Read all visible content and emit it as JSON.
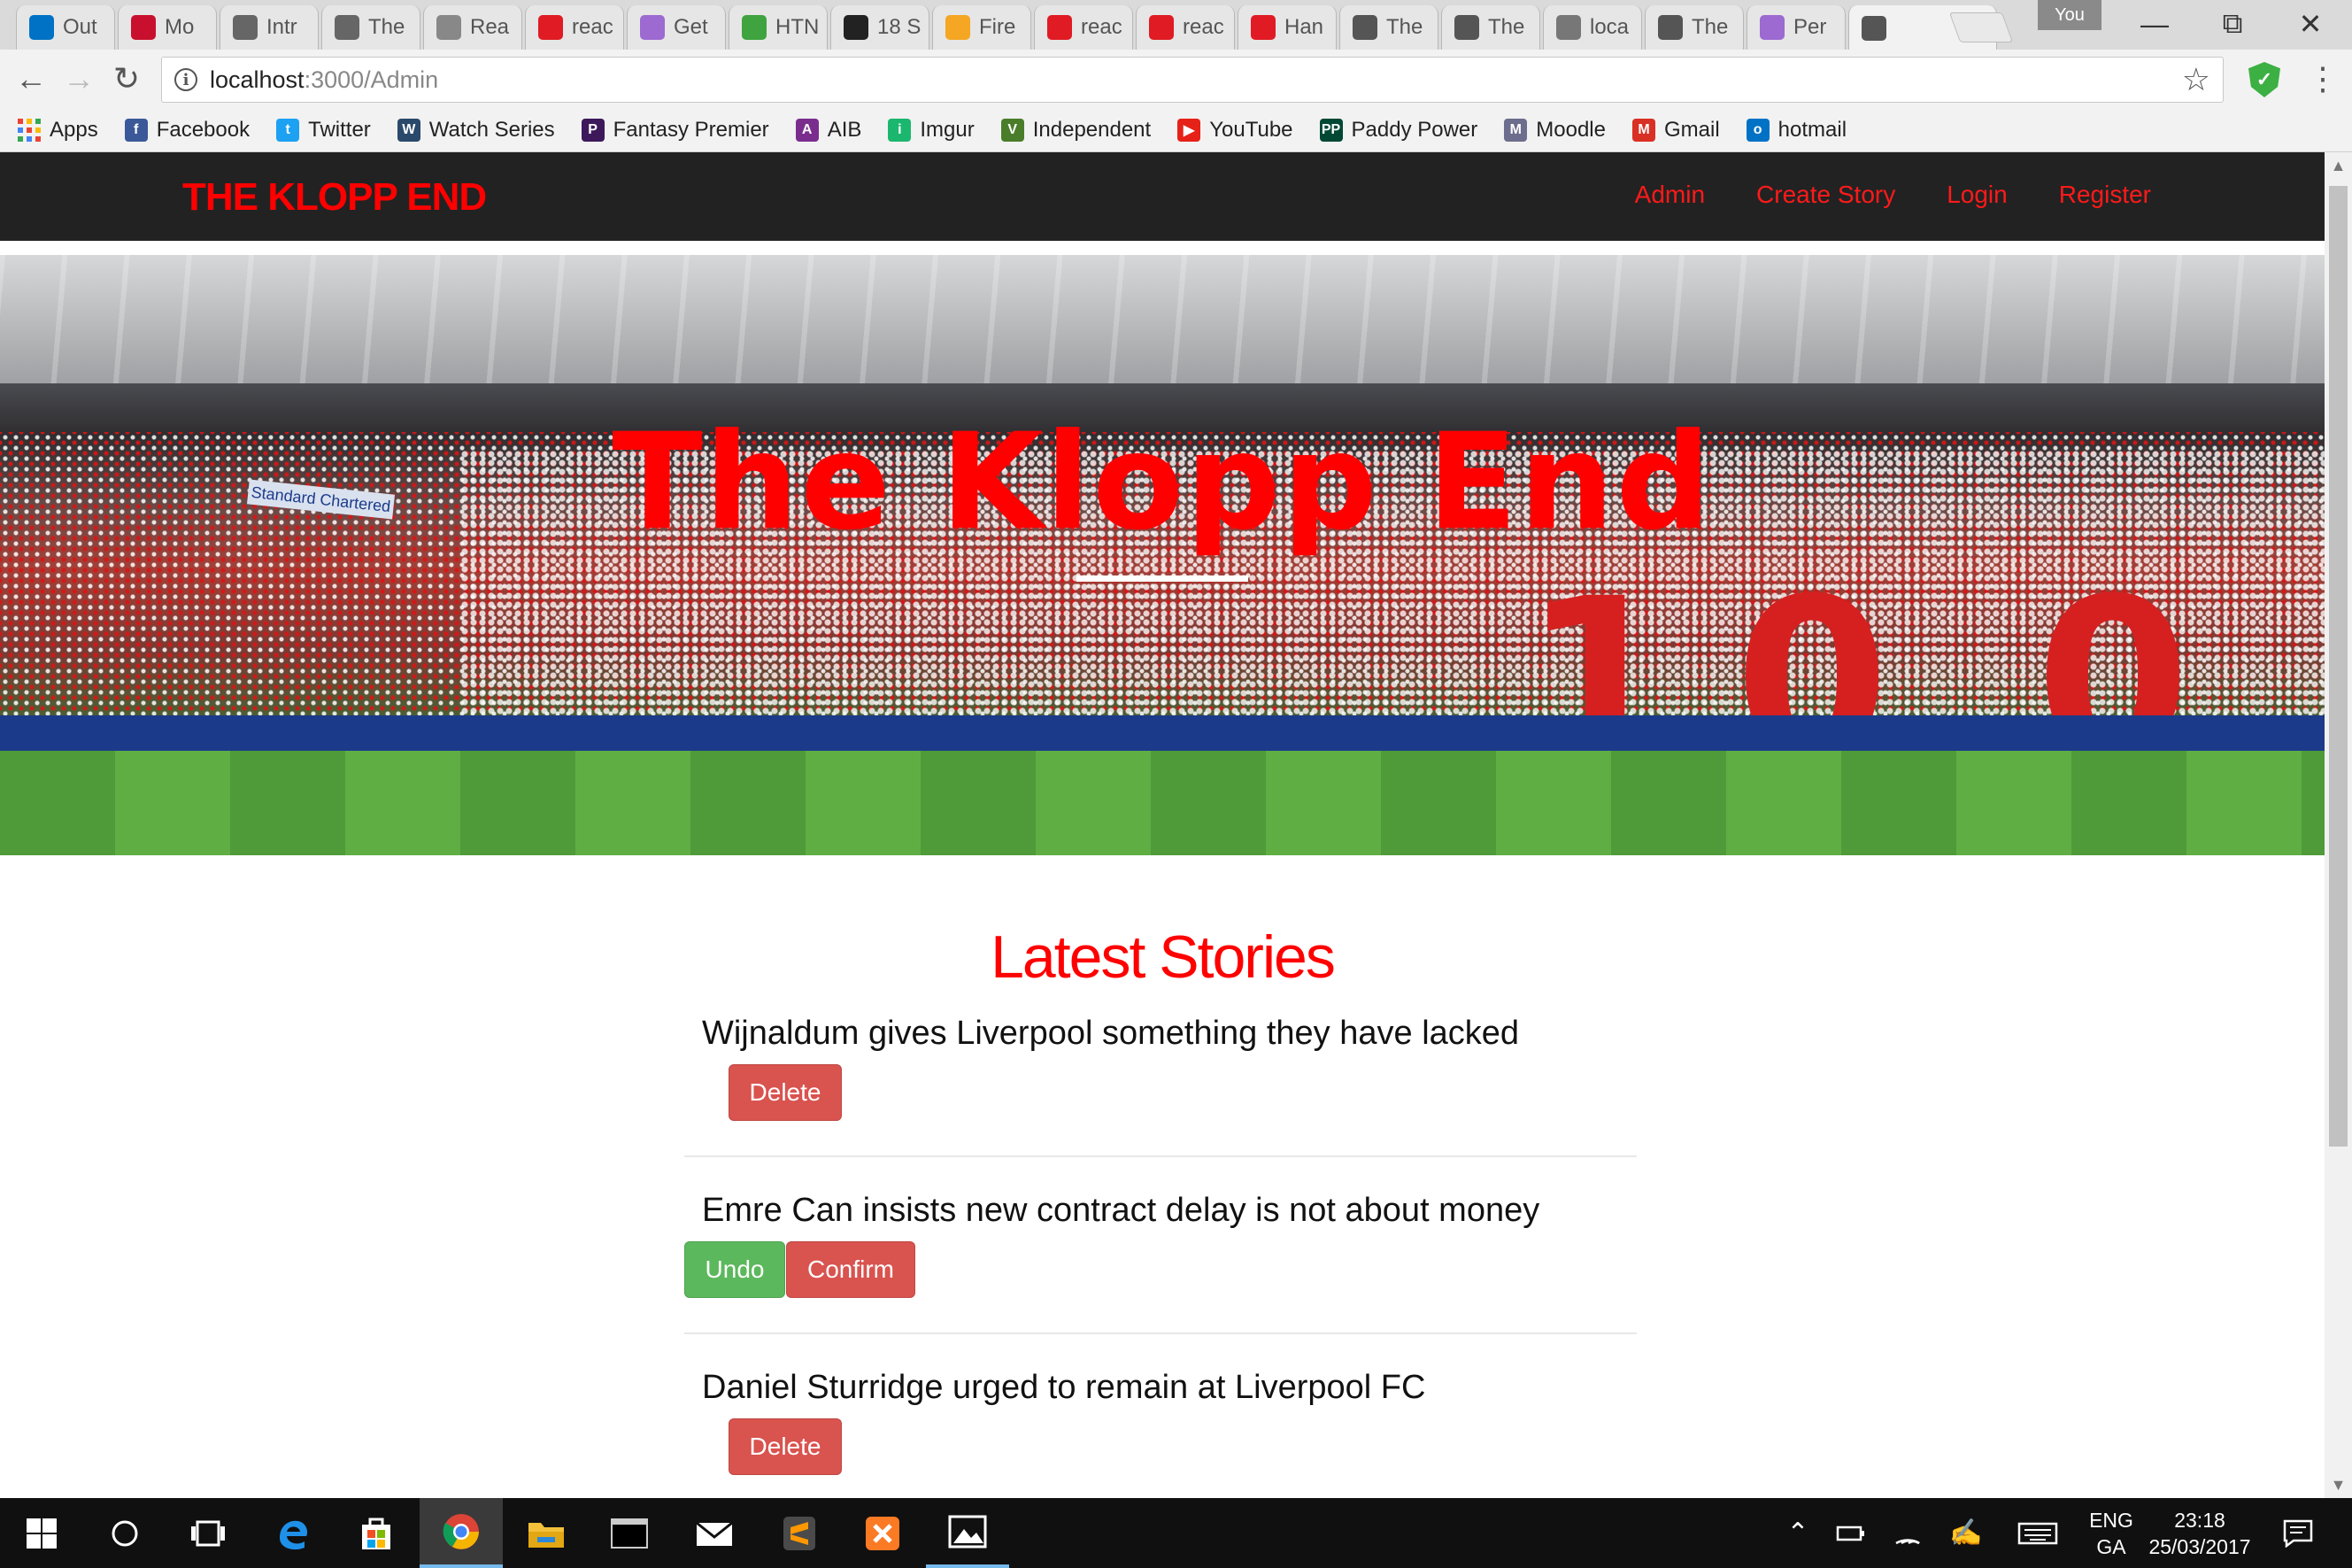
{
  "browser": {
    "tabs": [
      {
        "label": "Out",
        "icon": "outlook-icon",
        "color": "#0072c6"
      },
      {
        "label": "Mo",
        "icon": "liverpool-crest-icon",
        "color": "#c8102e"
      },
      {
        "label": "Intr",
        "icon": "book-icon",
        "color": "#666666"
      },
      {
        "label": "The",
        "icon": "book-icon",
        "color": "#666666"
      },
      {
        "label": "Rea",
        "icon": "list-icon",
        "color": "#888888"
      },
      {
        "label": "reac",
        "icon": "red-n-icon",
        "color": "#e01b24"
      },
      {
        "label": "Get",
        "icon": "heroku-icon",
        "color": "#9c6ad1"
      },
      {
        "label": "HTN",
        "icon": "html-icon",
        "color": "#3fa33f"
      },
      {
        "label": "18 S",
        "icon": "codepen-icon",
        "color": "#222222"
      },
      {
        "label": "Fire",
        "icon": "firebase-icon",
        "color": "#f5a623"
      },
      {
        "label": "reac",
        "icon": "red-n-icon",
        "color": "#e01b24"
      },
      {
        "label": "reac",
        "icon": "red-n-icon",
        "color": "#e01b24"
      },
      {
        "label": "Han",
        "icon": "hanging-icon",
        "color": "#e01b24"
      },
      {
        "label": "The",
        "icon": "react-icon",
        "color": "#555555"
      },
      {
        "label": "The",
        "icon": "react-icon",
        "color": "#555555"
      },
      {
        "label": "loca",
        "icon": "gear-icon",
        "color": "#777777"
      },
      {
        "label": "The",
        "icon": "react-icon",
        "color": "#555555"
      },
      {
        "label": "Per",
        "icon": "heroku-icon",
        "color": "#9c6ad1"
      },
      {
        "label": "",
        "icon": "react-icon",
        "color": "#555555",
        "active": true
      }
    ],
    "profile_label": "You",
    "url_host": "localhost",
    "url_path": ":3000/Admin",
    "bookmarks": [
      {
        "label": "Apps",
        "icon": "apps-grid-icon",
        "color": "#4285f4"
      },
      {
        "label": "Facebook",
        "icon": "facebook-icon",
        "color": "#3b5998",
        "glyph": "f"
      },
      {
        "label": "Twitter",
        "icon": "twitter-icon",
        "color": "#1da1f2",
        "glyph": "t"
      },
      {
        "label": "Watch Series",
        "icon": "watch-series-icon",
        "color": "#2a4a6b",
        "glyph": "W"
      },
      {
        "label": "Fantasy Premier",
        "icon": "premier-league-icon",
        "color": "#3d195b",
        "glyph": "P"
      },
      {
        "label": "AIB",
        "icon": "aib-icon",
        "color": "#7b2d8e",
        "glyph": "A"
      },
      {
        "label": "Imgur",
        "icon": "imgur-icon",
        "color": "#1bb76e",
        "glyph": "i"
      },
      {
        "label": "Independent",
        "icon": "independent-icon",
        "color": "#4a7d2a",
        "glyph": "V"
      },
      {
        "label": "YouTube",
        "icon": "youtube-icon",
        "color": "#e62117",
        "glyph": "▶"
      },
      {
        "label": "Paddy Power",
        "icon": "paddy-power-icon",
        "color": "#004833",
        "glyph": "PP"
      },
      {
        "label": "Moodle",
        "icon": "moodle-icon",
        "color": "#6d6d8d",
        "glyph": "M"
      },
      {
        "label": "Gmail",
        "icon": "gmail-icon",
        "color": "#d93025",
        "glyph": "M"
      },
      {
        "label": "hotmail",
        "icon": "outlook-icon",
        "color": "#0072c6",
        "glyph": "o"
      }
    ]
  },
  "site": {
    "brand": "THE KLOPP END",
    "nav": [
      "Admin",
      "Create Story",
      "Login",
      "Register"
    ],
    "hero_title": "The Klopp End",
    "hero_banner_text": "Standard Chartered",
    "latest_heading": "Latest Stories",
    "stories": [
      {
        "title": "Wijnaldum gives Liverpool something they have lacked",
        "state": "normal",
        "delete_label": "Delete"
      },
      {
        "title": "Emre Can insists new contract delay is not about money",
        "state": "confirming",
        "undo_label": "Undo",
        "confirm_label": "Confirm"
      },
      {
        "title": "Daniel Sturridge urged to remain at Liverpool FC",
        "state": "normal",
        "delete_label": "Delete"
      }
    ]
  },
  "taskbar": {
    "lang_line1": "ENG",
    "lang_line2": "GA",
    "time": "23:18",
    "date": "25/03/2017"
  },
  "colors": {
    "brand_red": "#ff0000",
    "nav_bg": "#222222",
    "danger": "#d9534f",
    "success": "#5cb85c"
  }
}
